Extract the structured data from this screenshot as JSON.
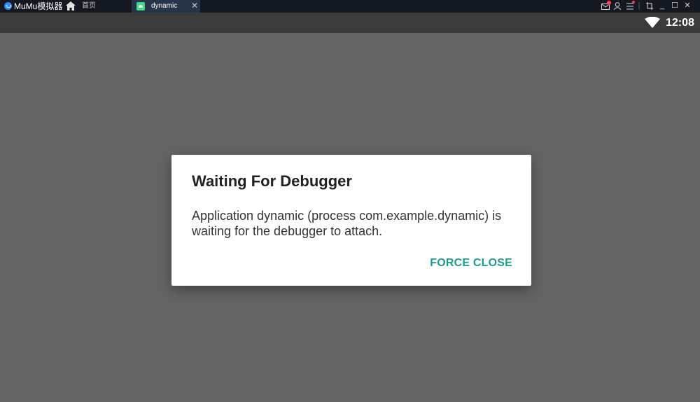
{
  "emulator": {
    "app_name": "MuMu模拟器",
    "home_label": "首页",
    "tab": {
      "label": "dynamic",
      "close": "✕"
    },
    "window_controls": {
      "minimize": "_",
      "maximize": "☐",
      "close": "✕"
    },
    "accent": "#2f8cff"
  },
  "statusbar": {
    "time": "12:08"
  },
  "dialog": {
    "title": "Waiting For Debugger",
    "message": "Application dynamic (process com.example.dynamic) is waiting for the debugger to attach.",
    "button": "FORCE CLOSE",
    "button_color": "#1a9e8c"
  }
}
